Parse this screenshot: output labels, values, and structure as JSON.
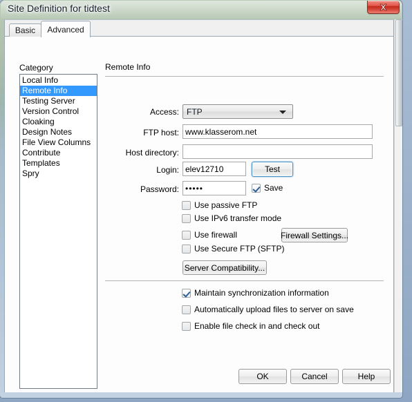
{
  "window": {
    "title": "Site Definition for tidtest",
    "close_label": "Close"
  },
  "tabs": [
    {
      "label": "Basic",
      "active": false
    },
    {
      "label": "Advanced",
      "active": true
    }
  ],
  "category": {
    "label": "Category",
    "items": [
      {
        "label": "Local Info",
        "selected": false
      },
      {
        "label": "Remote Info",
        "selected": true
      },
      {
        "label": "Testing Server",
        "selected": false
      },
      {
        "label": "Version Control",
        "selected": false
      },
      {
        "label": "Cloaking",
        "selected": false
      },
      {
        "label": "Design Notes",
        "selected": false
      },
      {
        "label": "File View Columns",
        "selected": false
      },
      {
        "label": "Contribute",
        "selected": false
      },
      {
        "label": "Templates",
        "selected": false
      },
      {
        "label": "Spry",
        "selected": false
      }
    ]
  },
  "main": {
    "section_title": "Remote Info",
    "fields": {
      "access_label": "Access:",
      "access_value": "FTP",
      "ftp_host_label": "FTP host:",
      "ftp_host_value": "www.klasserom.net",
      "ftp_host_placeholder": "",
      "host_directory_label": "Host directory:",
      "host_directory_value": "",
      "host_directory_placeholder": "",
      "login_label": "Login:",
      "login_value": "elev12710",
      "login_placeholder": "",
      "password_label": "Password:",
      "password_value": "•••••",
      "password_placeholder": ""
    },
    "test_button": "Test",
    "save_checkbox": {
      "label": "Save",
      "checked": true
    },
    "options": [
      {
        "label": "Use passive FTP",
        "checked": false
      },
      {
        "label": "Use IPv6 transfer mode",
        "checked": false
      },
      {
        "label": "Use firewall",
        "checked": false
      },
      {
        "label": "Use Secure FTP (SFTP)",
        "checked": false
      }
    ],
    "firewall_settings_button": "Firewall Settings...",
    "server_compatibility_button": "Server Compatibility...",
    "sync_options": [
      {
        "label": "Maintain synchronization information",
        "checked": true
      },
      {
        "label": "Automatically upload files to server on save",
        "checked": false
      },
      {
        "label": "Enable file check in and check out",
        "checked": false
      }
    ]
  },
  "footer": {
    "ok_label": "OK",
    "cancel_label": "Cancel",
    "help_label": "Help"
  },
  "colors": {
    "selection_blue": "#3399ff",
    "close_red": "#c3291d",
    "focus_blue": "#4a90c4"
  }
}
